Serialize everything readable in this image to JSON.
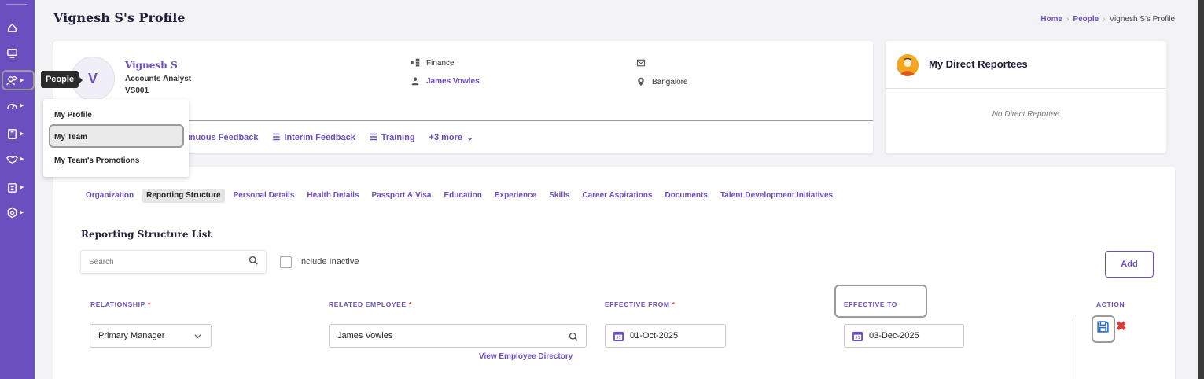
{
  "nav_rail": {
    "items": [
      "home-icon",
      "monitor-icon",
      "people-icon",
      "dashboard-icon",
      "book-icon",
      "handshake-icon",
      "clipboard-icon",
      "settings-icon"
    ],
    "tooltip": "People",
    "flyout": [
      "My Profile",
      "My Team",
      "My Team's Promotions"
    ]
  },
  "header": {
    "title": "Vignesh S's Profile",
    "breadcrumb": [
      "Home",
      "People",
      "Vignesh S's Profile"
    ]
  },
  "profile": {
    "initial": "V",
    "name": "Vignesh S",
    "role": "Accounts Analyst",
    "code": "VS001",
    "department": "Finance",
    "manager": "James Vowles",
    "location": "Bangalore",
    "feedback_links": [
      "tinuous Feedback",
      "Interim Feedback",
      "Training",
      "+3 more"
    ]
  },
  "reportees": {
    "title": "My Direct Reportees",
    "empty": "No Direct Reportee"
  },
  "tabs": [
    "Organization",
    "Reporting Structure",
    "Personal Details",
    "Health Details",
    "Passport & Visa",
    "Education",
    "Experience",
    "Skills",
    "Career Aspirations",
    "Documents",
    "Talent Development Initiatives"
  ],
  "active_tab": "Reporting Structure",
  "section": {
    "title": "Reporting Structure List",
    "search_placeholder": "Search",
    "include_inactive": "Include Inactive",
    "add": "Add"
  },
  "table": {
    "headers": {
      "relationship": "RELATIONSHIP",
      "related_employee": "RELATED EMPLOYEE",
      "effective_from": "EFFECTIVE FROM",
      "effective_to": "EFFECTIVE TO",
      "action": "ACTION"
    },
    "required_mark": "*",
    "row": {
      "relationship": "Primary Manager",
      "related_employee": "James Vowles",
      "effective_from": "01-Oct-2025",
      "effective_to": "03-Dec-2025"
    },
    "directory_link": "View Employee Directory"
  },
  "colors": {
    "accent": "#6b4fbf",
    "danger": "#e53935"
  }
}
